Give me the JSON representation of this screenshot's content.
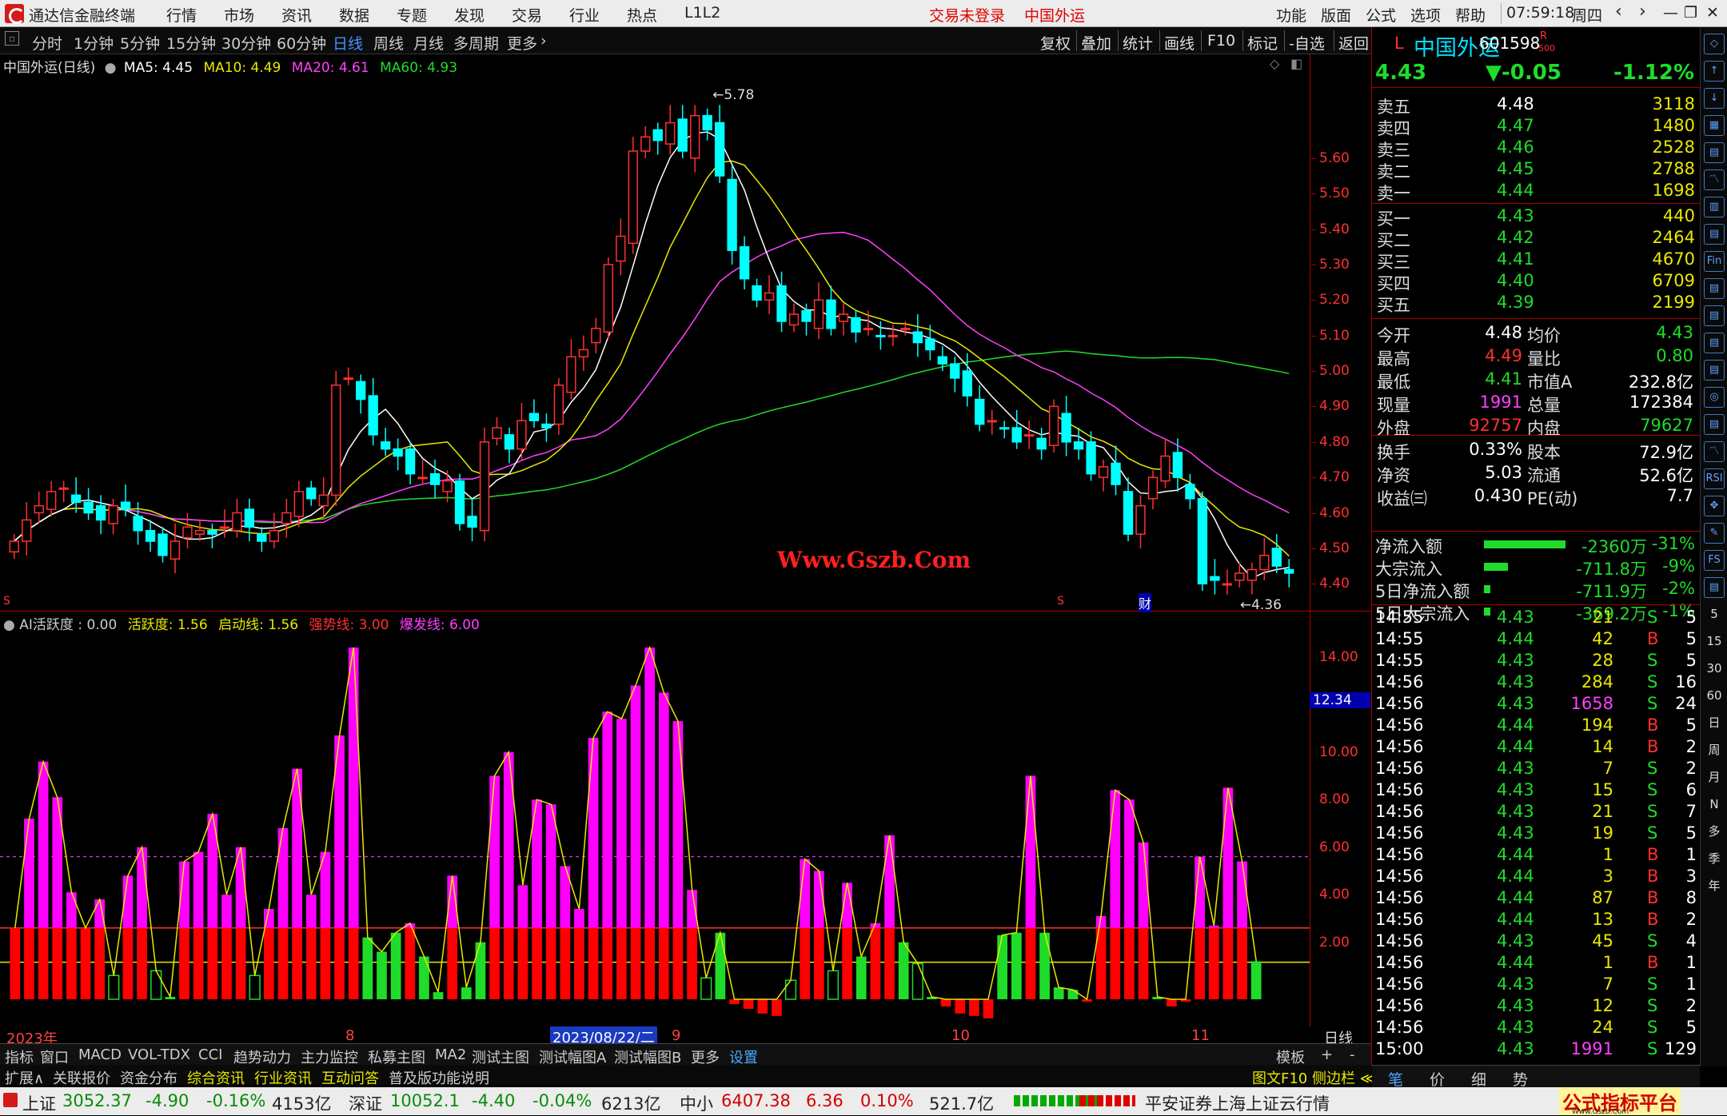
{
  "app": {
    "title": "通达信金融终端",
    "menu": [
      "行情",
      "市场",
      "资讯",
      "数据",
      "专题",
      "发现",
      "交易",
      "行业",
      "热点",
      "L1L2"
    ],
    "trade_status": "交易未登录",
    "stock_name_title": "中国外运",
    "right_menu": [
      "功能",
      "版面",
      "公式",
      "选项",
      "帮助"
    ],
    "clock": "07:59:18",
    "weekday": "周四"
  },
  "periods": {
    "items": [
      "分时",
      "1分钟",
      "5分钟",
      "15分钟",
      "30分钟",
      "60分钟",
      "日线",
      "周线",
      "月线",
      "多周期",
      "更多"
    ],
    "active": "日线",
    "tools": [
      "复权",
      "叠加",
      "统计",
      "画线",
      "F10",
      "标记",
      "-自选",
      "返回"
    ]
  },
  "main_chart": {
    "header_name": "中国外运(日线)",
    "ma5": "MA5: 4.45",
    "ma10": "MA10: 4.49",
    "ma20": "MA20: 4.61",
    "ma60": "MA60: 4.93",
    "high_mark": "5.78",
    "low_mark": "4.36",
    "watermark": "Www.Gszb.Com",
    "marker_s1": "S",
    "marker_s2": "S",
    "marker_cai": "财",
    "price_ticks": [
      "5.60",
      "5.50",
      "5.40",
      "5.30",
      "5.20",
      "5.10",
      "5.00",
      "4.90",
      "4.80",
      "4.70",
      "4.60",
      "4.50",
      "4.40"
    ],
    "colors": {
      "up": "#ff3030",
      "down": "#00ffff",
      "ma5": "#ffffff",
      "ma10": "#e8e800",
      "ma20": "#ff40ff",
      "ma60": "#1fdc2a"
    }
  },
  "chart_data": [
    {
      "type": "candlestick",
      "title": "中国外运(日线)",
      "ylim": [
        4.36,
        5.78
      ],
      "series": [
        {
          "name": "MA5",
          "last": 4.45
        },
        {
          "name": "MA10",
          "last": 4.49
        },
        {
          "name": "MA20",
          "last": 4.61
        },
        {
          "name": "MA60",
          "last": 4.93
        }
      ],
      "closes": [
        4.52,
        4.58,
        4.62,
        4.66,
        4.67,
        4.63,
        4.6,
        4.58,
        4.62,
        4.61,
        4.55,
        4.52,
        4.48,
        4.52,
        4.56,
        4.55,
        4.54,
        4.56,
        4.6,
        4.56,
        4.52,
        4.55,
        4.6,
        4.66,
        4.64,
        4.65,
        4.96,
        4.98,
        4.92,
        4.82,
        4.78,
        4.76,
        4.71,
        4.7,
        4.68,
        4.69,
        4.57,
        4.56,
        4.8,
        4.84,
        4.78,
        4.86,
        4.86,
        4.84,
        4.96,
        5.04,
        5.06,
        5.12,
        5.3,
        5.38,
        5.62,
        5.66,
        5.65,
        5.7,
        5.62,
        5.72,
        5.68,
        5.55,
        5.34,
        5.26,
        5.2,
        5.22,
        5.14,
        5.16,
        5.14,
        5.2,
        5.12,
        5.16,
        5.11,
        5.12,
        5.1,
        5.1,
        5.12,
        5.08,
        5.06,
        5.02,
        4.98,
        4.93,
        4.85,
        4.86,
        4.84,
        4.8,
        4.82,
        4.78,
        4.9,
        4.8,
        4.78,
        4.71,
        4.73,
        4.68,
        4.54,
        4.62,
        4.7,
        4.76,
        4.7,
        4.64,
        4.4,
        4.41,
        4.4,
        4.43,
        4.44,
        4.48,
        4.45,
        4.43
      ]
    },
    {
      "type": "bar",
      "title": "AI活跃度",
      "ylim": [
        0,
        15
      ],
      "values": [
        3,
        7.6,
        10,
        8.5,
        4.5,
        3,
        4.2,
        1,
        5.2,
        6.4,
        1.2,
        0.1,
        5.8,
        6.2,
        7.8,
        4.4,
        6.4,
        1,
        3.8,
        7.2,
        9.7,
        4.4,
        6.2,
        11.1,
        14.8,
        2.6,
        2,
        2.8,
        3.2,
        1.8,
        0.3,
        5.2,
        0.5,
        2.4,
        9.4,
        10.4,
        4.8,
        8.4,
        8.2,
        5.6,
        3.8,
        11.0,
        12.1,
        11.8,
        13.2,
        14.8,
        12.9,
        11.7,
        4.6,
        0.9,
        2.8,
        -0.2,
        -0.4,
        -0.6,
        -0.7,
        0.8,
        5.9,
        5.4,
        1.2,
        4.9,
        1.8,
        3.2,
        6.9,
        2.4,
        1.5,
        0.1,
        -0.3,
        -0.6,
        -0.7,
        -0.8,
        2.7,
        2.8,
        9.4,
        2.8,
        0.5,
        0.4,
        -0.1,
        3.5,
        8.8,
        8.4,
        6.6,
        0.1,
        -0.3,
        -0.1,
        6.0,
        3.1,
        8.9,
        5.8,
        1.6
      ],
      "lines": {
        "活跃度": 1.56,
        "启动线": 1.56,
        "强势线": 3.0,
        "爆发线": 6.0
      },
      "current_mark": "12.34"
    }
  ],
  "sub_chart": {
    "header_name": "AI活跃度",
    "header_value": ": 0.00",
    "l1": "活跃度: 1.56",
    "l2": "启动线: 1.56",
    "l3": "强势线: 3.00",
    "l4": "爆发线: 6.00",
    "ticks": [
      "14.00",
      "12.00",
      "10.00",
      "8.00",
      "6.00",
      "4.00",
      "2.00"
    ],
    "current_mark": "12.34"
  },
  "date_axis": {
    "year": "2023年",
    "m8": "8",
    "selected": "2023/08/22/二",
    "m9": "9",
    "m10": "10",
    "m11": "11",
    "period": "日线"
  },
  "quote": {
    "code_prefix": "L",
    "name": "中国外运",
    "code": "601598",
    "badge": "R",
    "badge2": "500",
    "price": "4.43",
    "change": "▼-0.05",
    "change_pct": "-1.12%",
    "asks": [
      {
        "label": "卖五",
        "price": "4.48",
        "vol": "3118"
      },
      {
        "label": "卖四",
        "price": "4.47",
        "vol": "1480"
      },
      {
        "label": "卖三",
        "price": "4.46",
        "vol": "2528"
      },
      {
        "label": "卖二",
        "price": "4.45",
        "vol": "2788"
      },
      {
        "label": "卖一",
        "price": "4.44",
        "vol": "1698"
      }
    ],
    "bids": [
      {
        "label": "买一",
        "price": "4.43",
        "vol": "440"
      },
      {
        "label": "买二",
        "price": "4.42",
        "vol": "2464"
      },
      {
        "label": "买三",
        "price": "4.41",
        "vol": "4670"
      },
      {
        "label": "买四",
        "price": "4.40",
        "vol": "6709"
      },
      {
        "label": "买五",
        "price": "4.39",
        "vol": "2199"
      }
    ],
    "stats": [
      {
        "l1": "今开",
        "v1": "4.48",
        "c1": "wh",
        "l2": "均价",
        "v2": "4.43",
        "c2": "g"
      },
      {
        "l1": "最高",
        "v1": "4.49",
        "c1": "rd",
        "l2": "量比",
        "v2": "0.80",
        "c2": "g"
      },
      {
        "l1": "最低",
        "v1": "4.41",
        "c1": "g",
        "l2": "市值A",
        "v2": "232.8亿",
        "c2": "wh"
      },
      {
        "l1": "现量",
        "v1": "1991",
        "c1": "mg",
        "l2": "总量",
        "v2": "172384",
        "c2": "wh"
      },
      {
        "l1": "外盘",
        "v1": "92757",
        "c1": "rd",
        "l2": "内盘",
        "v2": "79627",
        "c2": "g"
      }
    ],
    "stats2": [
      {
        "l1": "换手",
        "v1": "0.33%",
        "l2": "股本",
        "v2": "72.9亿"
      },
      {
        "l1": "净资",
        "v1": "5.03",
        "l2": "流通",
        "v2": "52.6亿"
      },
      {
        "l1": "收益㈢",
        "v1": "0.430",
        "l2": "PE(动)",
        "v2": "7.7"
      }
    ],
    "flows": [
      {
        "label": "净流入额",
        "value": "-2360万",
        "pct": "-31%",
        "bar": 0.31
      },
      {
        "label": "大宗流入",
        "value": "-711.8万",
        "pct": "-9%",
        "bar": 0.09
      },
      {
        "label": "5日净流入额",
        "value": "-711.9万",
        "pct": "-2%",
        "bar": 0.02
      },
      {
        "label": "5日大宗流入",
        "value": "-369.2万",
        "pct": "-1%",
        "bar": 0.01
      }
    ],
    "ticks": [
      {
        "t": "14:55",
        "p": "4.43",
        "v": "21",
        "d": "S",
        "n": "5"
      },
      {
        "t": "14:55",
        "p": "4.44",
        "v": "42",
        "d": "B",
        "n": "5"
      },
      {
        "t": "14:55",
        "p": "4.43",
        "v": "28",
        "d": "S",
        "n": "5"
      },
      {
        "t": "14:56",
        "p": "4.43",
        "v": "284",
        "d": "S",
        "n": "16"
      },
      {
        "t": "14:56",
        "p": "4.43",
        "v": "1658",
        "d": "S",
        "n": "24"
      },
      {
        "t": "14:56",
        "p": "4.44",
        "v": "194",
        "d": "B",
        "n": "5"
      },
      {
        "t": "14:56",
        "p": "4.44",
        "v": "14",
        "d": "B",
        "n": "2"
      },
      {
        "t": "14:56",
        "p": "4.43",
        "v": "7",
        "d": "S",
        "n": "2"
      },
      {
        "t": "14:56",
        "p": "4.43",
        "v": "15",
        "d": "S",
        "n": "6"
      },
      {
        "t": "14:56",
        "p": "4.43",
        "v": "21",
        "d": "S",
        "n": "7"
      },
      {
        "t": "14:56",
        "p": "4.43",
        "v": "19",
        "d": "S",
        "n": "5"
      },
      {
        "t": "14:56",
        "p": "4.44",
        "v": "1",
        "d": "B",
        "n": "1"
      },
      {
        "t": "14:56",
        "p": "4.44",
        "v": "3",
        "d": "B",
        "n": "3"
      },
      {
        "t": "14:56",
        "p": "4.44",
        "v": "87",
        "d": "B",
        "n": "8"
      },
      {
        "t": "14:56",
        "p": "4.44",
        "v": "13",
        "d": "B",
        "n": "2"
      },
      {
        "t": "14:56",
        "p": "4.43",
        "v": "45",
        "d": "S",
        "n": "4"
      },
      {
        "t": "14:56",
        "p": "4.44",
        "v": "1",
        "d": "B",
        "n": "1"
      },
      {
        "t": "14:56",
        "p": "4.43",
        "v": "7",
        "d": "S",
        "n": "1"
      },
      {
        "t": "14:56",
        "p": "4.43",
        "v": "12",
        "d": "S",
        "n": "2"
      },
      {
        "t": "14:56",
        "p": "4.43",
        "v": "24",
        "d": "S",
        "n": "5"
      },
      {
        "t": "15:00",
        "p": "4.43",
        "v": "1991",
        "d": "S",
        "n": "129"
      }
    ],
    "bottom_tabs": [
      "笔",
      "价",
      "细",
      "势"
    ]
  },
  "icon_bar": [
    "◇",
    "↑",
    "↓",
    "▦",
    "▤",
    "〽",
    "▥",
    "▤",
    "Fin",
    "▤",
    "▤",
    "▤",
    "▤",
    "◎",
    "▤",
    "〽",
    "RSI",
    "✥",
    "✎",
    "FS",
    "▤",
    "5",
    "15",
    "30",
    "60",
    "日",
    "周",
    "月",
    "N",
    "多",
    "季",
    "年"
  ],
  "bottom_tabs1": [
    "指标",
    "窗口",
    "MACD",
    "VOL-TDX",
    "CCI",
    "趋势动力",
    "主力监控",
    "私募主图",
    "MA2",
    "测试主图",
    "测试幅图A",
    "测试幅图B",
    "更多",
    "设置",
    "模板",
    "+",
    "-"
  ],
  "bottom_tabs2": [
    {
      "label": "扩展∧",
      "color": "#ccc"
    },
    {
      "label": "关联报价",
      "color": "#ccc"
    },
    {
      "label": "资金分布",
      "color": "#ccc"
    },
    {
      "label": "综合资讯",
      "color": "#e8e800"
    },
    {
      "label": "行业资讯",
      "color": "#e8e800"
    },
    {
      "label": "互动问答",
      "color": "#e8e800"
    },
    {
      "label": "普及版功能说明",
      "color": "#ccc"
    }
  ],
  "side_toggle": "图文F10 侧边栏 ≪",
  "status_bar": {
    "sh_label": "上证",
    "sh_value": "3052.37",
    "sh_change": "-4.90",
    "sh_pct": "-0.16%",
    "sh_amount": "4153亿",
    "sz_label": "深证",
    "sz_value": "10052.1",
    "sz_change": "-4.40",
    "sz_pct": "-0.04%",
    "sz_amount": "6213亿",
    "zx_label": "中小",
    "zx_value": "6407.38",
    "zx_change": "6.36",
    "zx_pct": "0.10%",
    "zx_amount": "521.7亿",
    "server": "平安证券上海上证云行情",
    "brand": "公式指标平台",
    "brand_url": "Www.Gszb.Com"
  }
}
